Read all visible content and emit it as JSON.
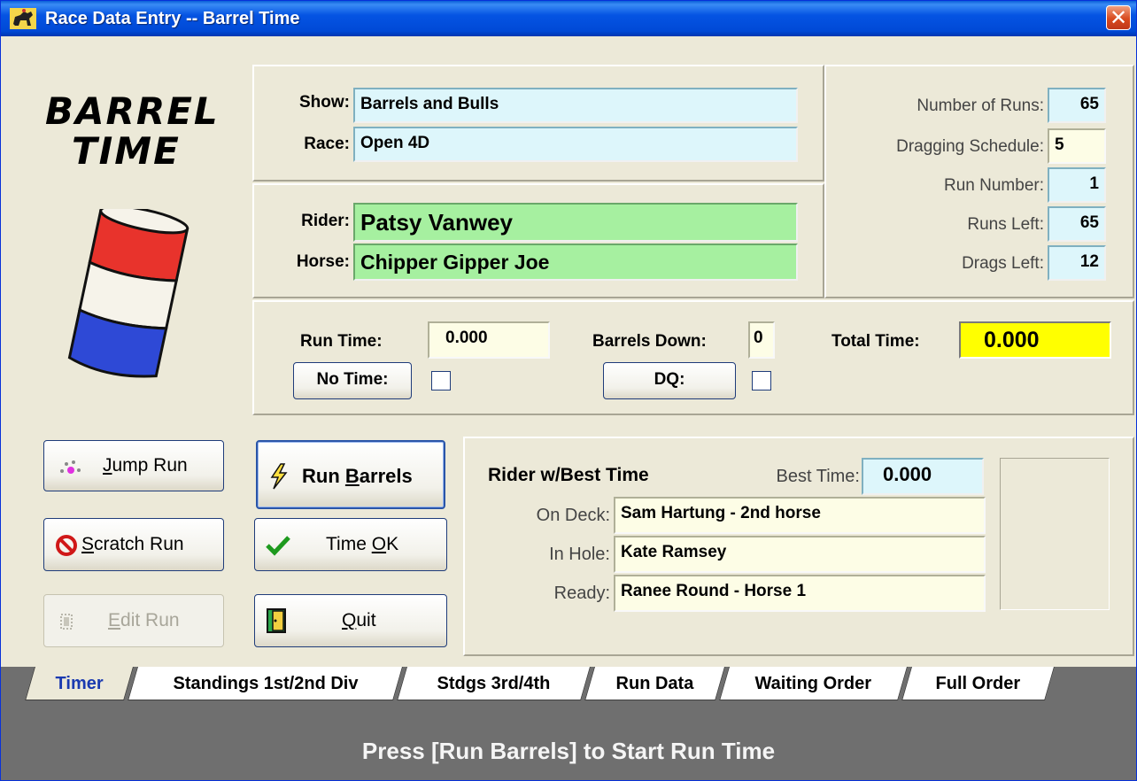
{
  "window": {
    "title": "Race Data Entry -- Barrel Time",
    "close_label": "✕"
  },
  "logo": {
    "line1": "BARREL",
    "line2": "TIME",
    "barrel_colors": [
      "#E8332C",
      "#F6F3EA",
      "#2E49D6"
    ]
  },
  "show_race": {
    "show_label": "Show:",
    "show_value": "Barrels and Bulls",
    "race_label": "Race:",
    "race_value": "Open 4D"
  },
  "rider_horse": {
    "rider_label": "Rider:",
    "rider_value": "Patsy Vanwey",
    "horse_label": "Horse:",
    "horse_value": "Chipper Gipper Joe"
  },
  "stats": [
    {
      "label": "Number of Runs:",
      "value": "65"
    },
    {
      "label": "Dragging Schedule:",
      "value": "5"
    },
    {
      "label": "Run Number:",
      "value": "1"
    },
    {
      "label": "Runs Left:",
      "value": "65"
    },
    {
      "label": "Drags Left:",
      "value": "12"
    }
  ],
  "timing": {
    "run_time_label": "Run Time:",
    "run_time_value": "0.000",
    "barrels_down_label": "Barrels Down:",
    "barrels_down_value": "0",
    "total_time_label": "Total Time:",
    "total_time_value": "0.000",
    "no_time_label": "No Time:",
    "dq_label": "DQ:"
  },
  "buttons": {
    "jump_run": {
      "pre": "",
      "key": "J",
      "post": "ump Run"
    },
    "scratch_run": {
      "pre": "",
      "key": "S",
      "post": "cratch Run"
    },
    "edit_run": {
      "pre": "",
      "key": "E",
      "post": "dit Run"
    },
    "run_barrels": {
      "pre": "Run ",
      "key": "B",
      "post": "arrels"
    },
    "time_ok": {
      "pre": "Time ",
      "key": "O",
      "post": "K"
    },
    "quit": {
      "pre": "",
      "key": "Q",
      "post": "uit"
    }
  },
  "queue": {
    "best_rider_label": "Rider w/Best Time",
    "best_time_label": "Best Time:",
    "best_time_value": "0.000",
    "on_deck_label": "On Deck:",
    "on_deck_value": "Sam Hartung - 2nd horse",
    "in_hole_label": "In Hole:",
    "in_hole_value": "Kate Ramsey",
    "ready_label": "Ready:",
    "ready_value": "Ranee Round - Horse 1"
  },
  "tabs": [
    "Timer",
    "Standings 1st/2nd Div",
    "Stdgs 3rd/4th",
    "Run Data",
    "Waiting Order",
    "Full Order"
  ],
  "active_tab": "Timer",
  "status_text": "Press [Run Barrels] to Start Run Time",
  "colors": {
    "title_bar": "#0554E3",
    "window_bg": "#ECE9D8",
    "cyan_field": "#DDF6FB",
    "green_field": "#A6F0A0",
    "cream_field": "#FDFDE6",
    "total_time_bg": "#FFFF00",
    "tab_area": "#6F6F6F"
  }
}
